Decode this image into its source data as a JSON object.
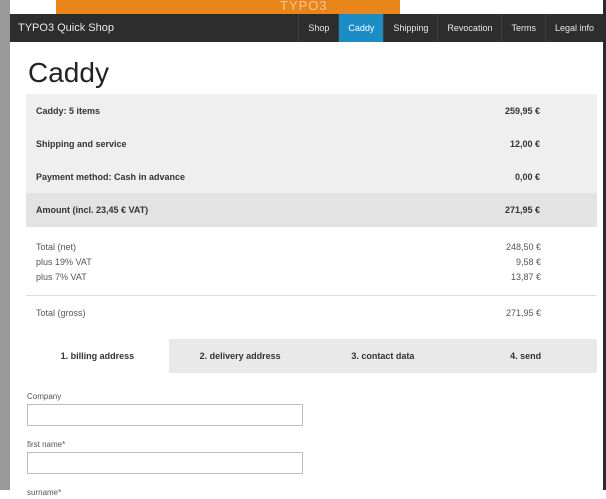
{
  "header": {
    "background_logo": "TYPO3",
    "brand": "TYPO3 Quick Shop",
    "nav": [
      {
        "label": "Shop",
        "active": false
      },
      {
        "label": "Caddy",
        "active": true
      },
      {
        "label": "Shipping",
        "active": false
      },
      {
        "label": "Revocation",
        "active": false
      },
      {
        "label": "Terms",
        "active": false
      },
      {
        "label": "Legal info",
        "active": false
      }
    ]
  },
  "colors": {
    "accent": "#1b8dc4",
    "top_bar": "#e9861a",
    "navbar": "#2d2d2d"
  },
  "page_title": "Caddy",
  "summary": {
    "caddy_label": "Caddy: 5 items",
    "caddy_value": "259,95 €",
    "shipping_label": "Shipping and service",
    "shipping_value": "12,00 €",
    "payment_label": "Payment method: Cash in advance",
    "payment_value": "0,00 €",
    "amount_label": "Amount (incl. 23,45 € VAT)",
    "amount_value": "271,95 €"
  },
  "details": {
    "net_label": "Total (net)",
    "net_value": "248,50 €",
    "vat19_label": "plus 19% VAT",
    "vat19_value": "9,58 €",
    "vat7_label": "plus 7% VAT",
    "vat7_value": "13,87 €",
    "gross_label": "Total (gross)",
    "gross_value": "271,95 €"
  },
  "steps": [
    {
      "label": "1. billing address",
      "active": true
    },
    {
      "label": "2. delivery address",
      "active": false
    },
    {
      "label": "3. contact data",
      "active": false
    },
    {
      "label": "4. send",
      "active": false
    }
  ],
  "form": {
    "company_label": "Company",
    "company_value": "",
    "first_name_label": "first name*",
    "first_name_value": "",
    "surname_label": "surname*"
  }
}
